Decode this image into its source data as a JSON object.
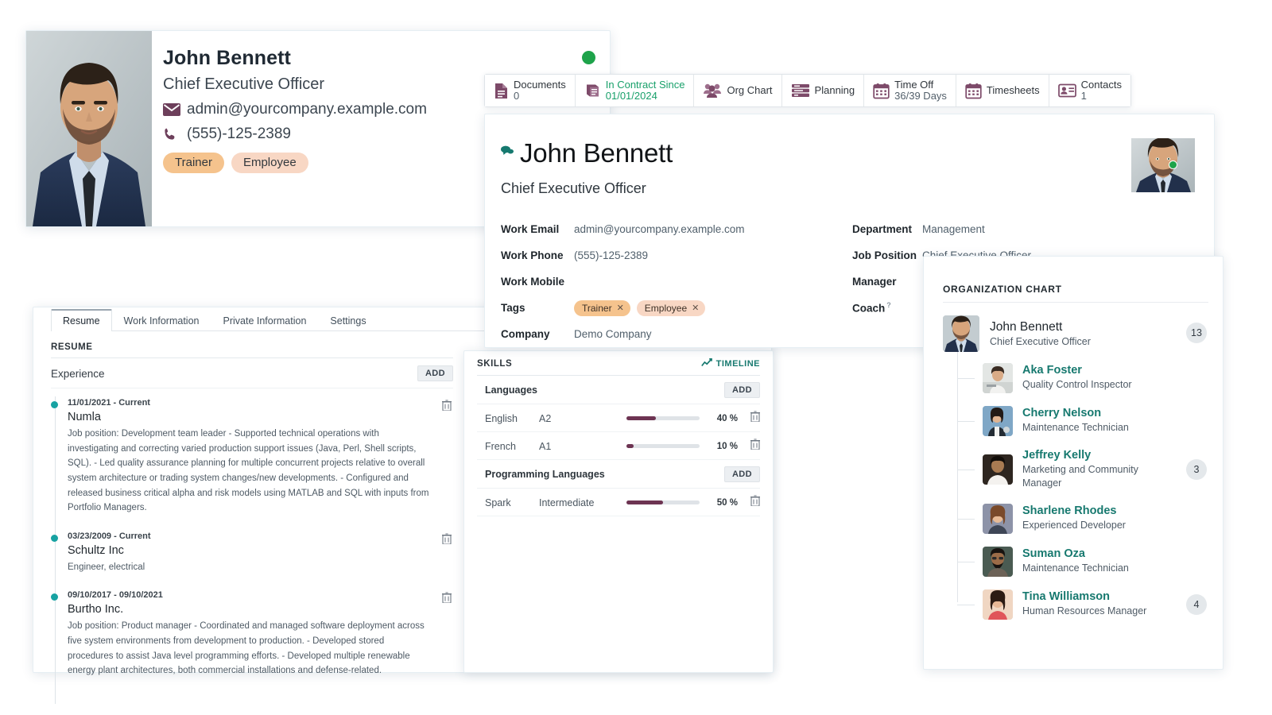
{
  "employee_card": {
    "name": "John Bennett",
    "job_title": "Chief Executive Officer",
    "email": "admin@yourcompany.example.com",
    "phone": "(555)-125-2389",
    "tags": [
      "Trainer",
      "Employee"
    ],
    "status_color": "#1ea34a"
  },
  "stat_buttons": [
    {
      "icon": "document-icon",
      "line1": "Documents",
      "line2": "0"
    },
    {
      "icon": "contract-icon",
      "line1": "In Contract Since",
      "line2": "01/01/2024",
      "accent": "#18a06a"
    },
    {
      "icon": "org-chart-icon",
      "line1": "Org Chart",
      "line2": ""
    },
    {
      "icon": "planning-icon",
      "line1": "Planning",
      "line2": ""
    },
    {
      "icon": "calendar-icon",
      "line1": "Time Off",
      "line2": "36/39 Days"
    },
    {
      "icon": "timesheet-icon",
      "line1": "Timesheets",
      "line2": ""
    },
    {
      "icon": "contacts-icon",
      "line1": "Contacts",
      "line2": "1"
    }
  ],
  "form": {
    "name": "John Bennett",
    "subtitle": "Chief Executive Officer",
    "left_fields": [
      {
        "label": "Work Email",
        "value": "admin@yourcompany.example.com"
      },
      {
        "label": "Work Phone",
        "value": "(555)-125-2389"
      },
      {
        "label": "Work Mobile",
        "value": ""
      },
      {
        "label": "Tags",
        "value": ""
      },
      {
        "label": "Company",
        "value": "Demo Company"
      }
    ],
    "tags": [
      {
        "label": "Trainer",
        "remove": "✕"
      },
      {
        "label": "Employee",
        "remove": "✕"
      }
    ],
    "right_fields": [
      {
        "label": "Department",
        "value": "Management"
      },
      {
        "label": "Job Position",
        "value": "Chief Executive Officer"
      },
      {
        "label": "Manager",
        "value": ""
      },
      {
        "label": "Coach",
        "value": "",
        "help": "?"
      }
    ]
  },
  "resume": {
    "tabs": [
      {
        "label": "Resume",
        "active": true
      },
      {
        "label": "Work Information",
        "active": false
      },
      {
        "label": "Private Information",
        "active": false
      },
      {
        "label": "Settings",
        "active": false
      }
    ],
    "section_title": "RESUME",
    "group_label": "Experience",
    "add_label": "ADD",
    "entries": [
      {
        "date": "11/01/2021 - Current",
        "org": "Numla",
        "desc": "Job position: Development team leader - Supported technical operations with investigating and correcting varied production support issues (Java, Perl, Shell scripts, SQL). - Led quality assurance planning for multiple concurrent projects relative to overall system architecture or trading system changes/new developments. - Configured and released business critical alpha and risk models using MATLAB and SQL with inputs from Portfolio Managers."
      },
      {
        "date": "03/23/2009 - Current",
        "org": "Schultz Inc",
        "desc": "Engineer, electrical"
      },
      {
        "date": "09/10/2017 - 09/10/2021",
        "org": "Burtho Inc.",
        "desc": "Job position: Product manager - Coordinated and managed software deployment across five system environments from development to production. - Developed stored procedures to assist Java level programming efforts. - Developed multiple renewable energy plant architectures, both commercial installations and defense-related."
      }
    ]
  },
  "skills": {
    "title": "SKILLS",
    "timeline_label": "TIMELINE",
    "add_label": "ADD",
    "groups": [
      {
        "name": "Languages",
        "rows": [
          {
            "name": "English",
            "level": "A2",
            "percent": 40,
            "percent_label": "40 %"
          },
          {
            "name": "French",
            "level": "A1",
            "percent": 10,
            "percent_label": "10 %"
          }
        ]
      },
      {
        "name": "Programming Languages",
        "rows": [
          {
            "name": "Spark",
            "level": "Intermediate",
            "percent": 50,
            "percent_label": "50 %"
          }
        ]
      }
    ],
    "bar_color": "#6d3452"
  },
  "org_chart": {
    "title": "ORGANIZATION CHART",
    "root": {
      "name": "John Bennett",
      "role": "Chief Executive Officer",
      "count": "13"
    },
    "children": [
      {
        "name": "Aka Foster",
        "role": "Quality Control Inspector",
        "count": ""
      },
      {
        "name": "Cherry Nelson",
        "role": "Maintenance Technician",
        "count": ""
      },
      {
        "name": "Jeffrey Kelly",
        "role": "Marketing and Community Manager",
        "count": "3"
      },
      {
        "name": "Sharlene Rhodes",
        "role": "Experienced Developer",
        "count": ""
      },
      {
        "name": "Suman Oza",
        "role": "Maintenance Technician",
        "count": ""
      },
      {
        "name": "Tina Williamson",
        "role": "Human Resources Manager",
        "count": "4"
      }
    ]
  }
}
